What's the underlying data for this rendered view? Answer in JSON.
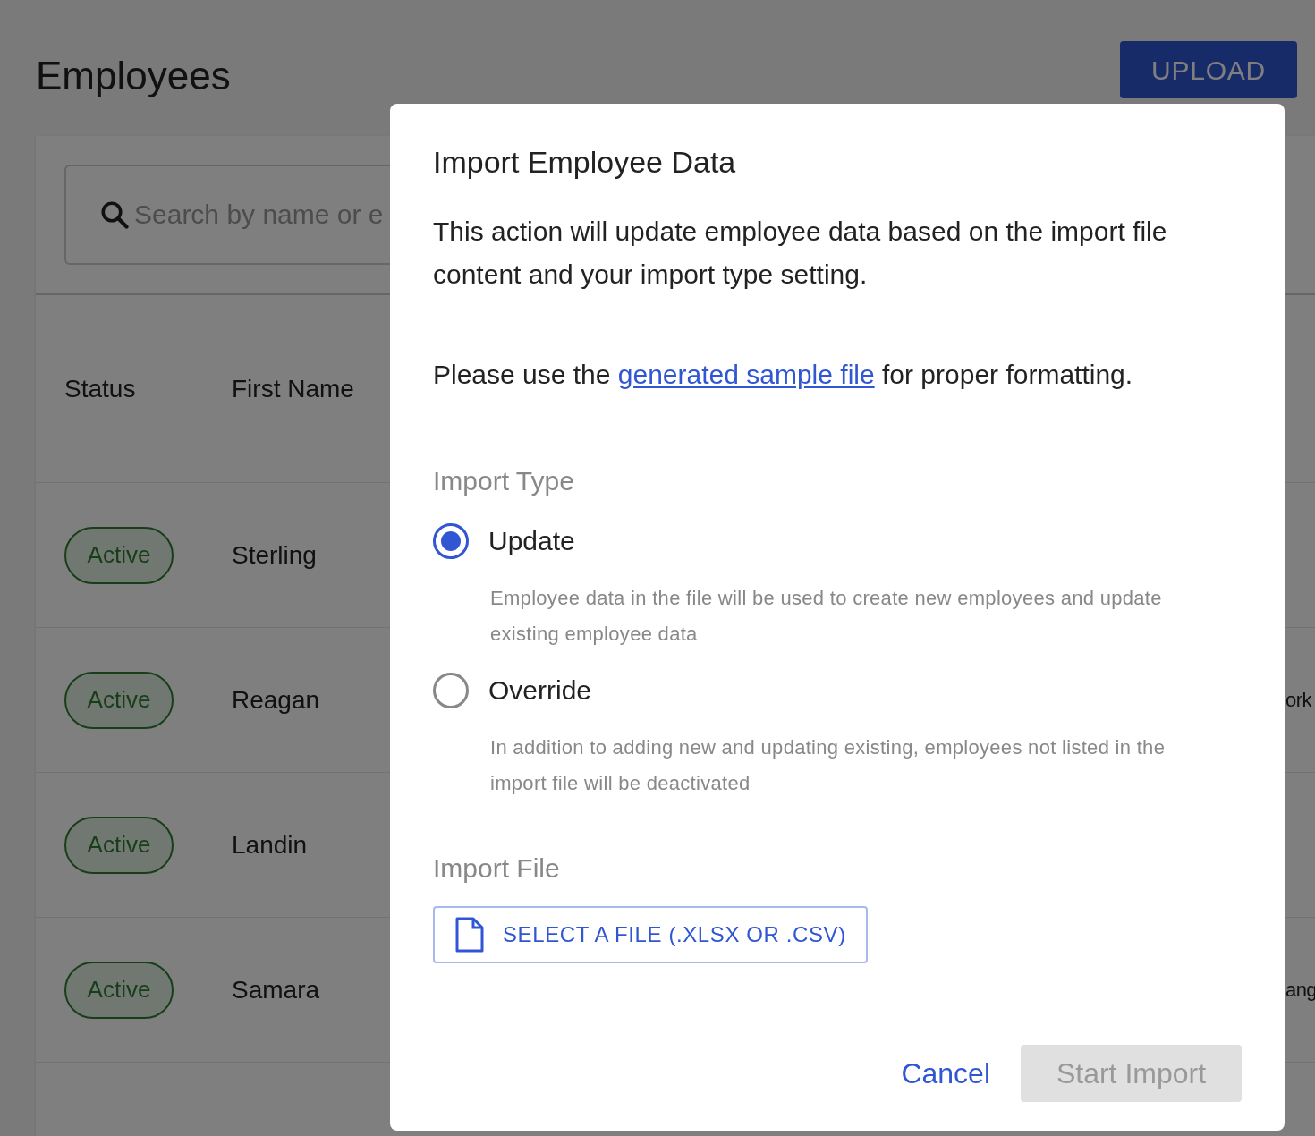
{
  "page": {
    "title": "Employees",
    "upload_button": "UPLOAD"
  },
  "search": {
    "placeholder": "Search by name or e"
  },
  "table": {
    "columns": [
      "Status",
      "First Name"
    ],
    "rows": [
      {
        "status": "Active",
        "first_name": "Sterling"
      },
      {
        "status": "Active",
        "first_name": "Reagan",
        "column_3": "ork"
      },
      {
        "status": "Active",
        "first_name": "Landin"
      },
      {
        "status": "Active",
        "first_name": "Samara",
        "column_3": "ang"
      }
    ]
  },
  "dialog": {
    "title": "Import Employee Data",
    "intro": "This action will update employee data based on the import file content and your import type setting.",
    "sample_before": "Please use the ",
    "sample_link": "generated sample file",
    "sample_after": " for proper formatting.",
    "import_type_label": "Import Type",
    "options": [
      {
        "label": "Update",
        "description": "Employee data in the file will be used to create new employees and update existing employee data",
        "selected": true
      },
      {
        "label": "Override",
        "description": "In addition to adding new and updating existing, employees not listed in the import file will be deactivated",
        "selected": false
      }
    ],
    "import_file_label": "Import File",
    "select_file_button": "SELECT A FILE (.XLSX OR .CSV)",
    "cancel_button": "Cancel",
    "start_button": {
      "label": "Start Import",
      "disabled": true
    }
  }
}
